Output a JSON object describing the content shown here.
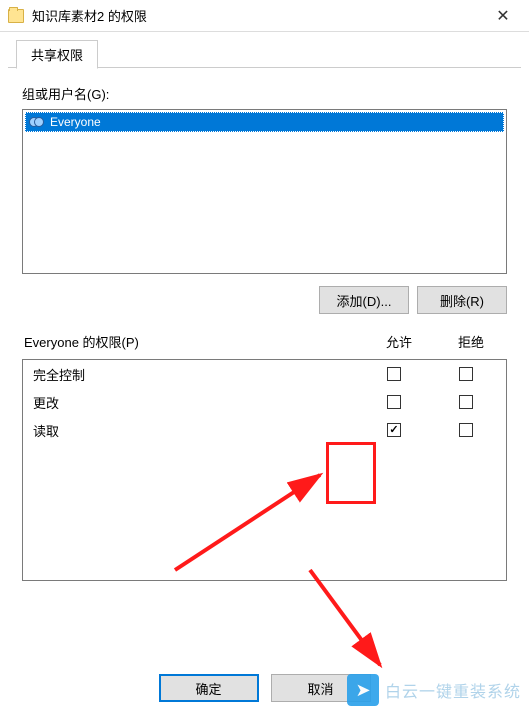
{
  "titlebar": {
    "title": "知识库素材2 的权限"
  },
  "tab": {
    "label": "共享权限"
  },
  "groups_label": "组或用户名(G):",
  "list": {
    "items": [
      {
        "name": "Everyone"
      }
    ]
  },
  "buttons": {
    "add": "添加(D)...",
    "remove": "删除(R)"
  },
  "perm_header": {
    "name": "Everyone 的权限(P)",
    "allow": "允许",
    "deny": "拒绝"
  },
  "perms": [
    {
      "name": "完全控制",
      "allow": false,
      "deny": false
    },
    {
      "name": "更改",
      "allow": false,
      "deny": false
    },
    {
      "name": "读取",
      "allow": true,
      "deny": false
    }
  ],
  "footer": {
    "ok": "确定",
    "cancel": "取消"
  },
  "watermark": "白云一键重装系统"
}
